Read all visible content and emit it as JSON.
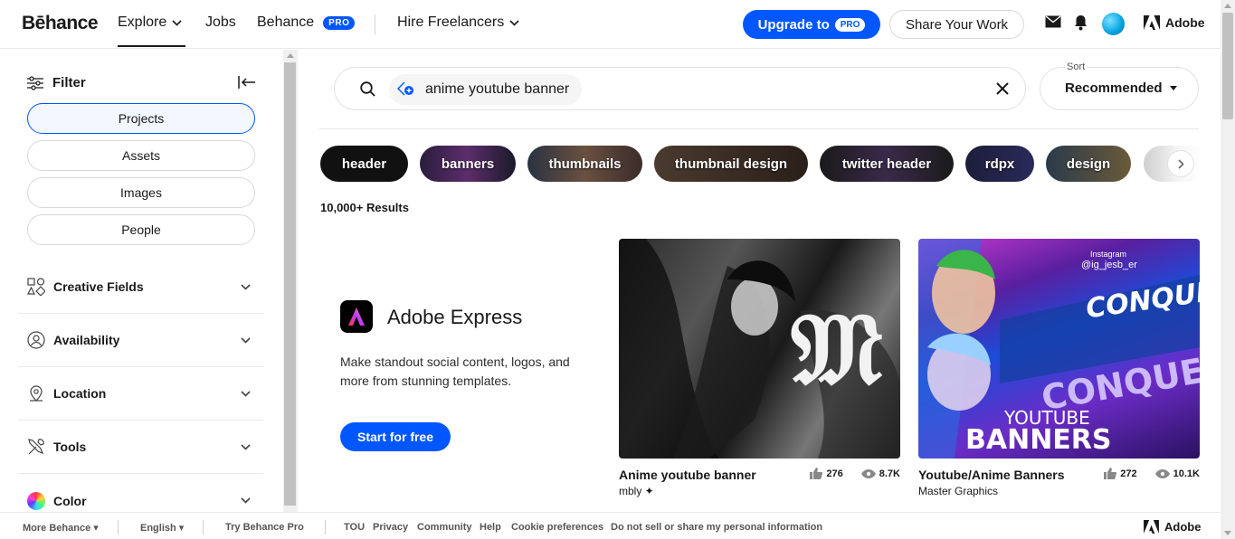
{
  "nav": {
    "logo": "Bēhance",
    "explore": "Explore",
    "jobs": "Jobs",
    "behance_pro": "Behance",
    "pro_badge": "PRO",
    "hire": "Hire Freelancers",
    "upgrade": "Upgrade to",
    "upgrade_badge": "PRO",
    "share": "Share Your Work",
    "adobe": "Adobe"
  },
  "sidebar": {
    "filter_label": "Filter",
    "types": [
      "Projects",
      "Assets",
      "Images",
      "People"
    ],
    "active_type": "Projects",
    "sections": [
      {
        "label": "Creative Fields",
        "icon": "creative-fields-icon"
      },
      {
        "label": "Availability",
        "icon": "availability-icon"
      },
      {
        "label": "Location",
        "icon": "location-pin-icon"
      },
      {
        "label": "Tools",
        "icon": "tools-icon"
      },
      {
        "label": "Color",
        "icon": "color-wheel-icon"
      }
    ]
  },
  "search": {
    "query": "anime youtube banner"
  },
  "sort": {
    "label": "Sort",
    "value": "Recommended"
  },
  "tags": [
    "header",
    "banners",
    "thumbnails",
    "thumbnail design",
    "twitter header",
    "rdpx",
    "design"
  ],
  "results_count": "10,000+ Results",
  "ad": {
    "title": "Adobe Express",
    "description": "Make standout social content, logos, and more from stunning templates.",
    "cta": "Start for free"
  },
  "projects": [
    {
      "title": "Anime youtube banner",
      "owner": "mbly ✦",
      "likes": "276",
      "views": "8.7K"
    },
    {
      "title": "Youtube/Anime Banners",
      "owner": "Master Graphics",
      "likes": "272",
      "views": "10.1K"
    }
  ],
  "thumb2_text": {
    "handle": "@ig_jesb_er",
    "instagram": "Instagram",
    "word1": "CONQUEST",
    "word2": "CONQUEST",
    "yt": "YOUTUBE",
    "banners": "BANNERS"
  },
  "footer": {
    "more": "More Behance",
    "lang": "English",
    "try_pro": "Try Behance Pro",
    "links": [
      "TOU",
      "Privacy",
      "Community",
      "Help",
      "Cookie preferences",
      "Do not sell or share my personal information"
    ],
    "adobe": "Adobe"
  },
  "colors": {
    "accent": "#0057ff",
    "text": "#191919"
  }
}
